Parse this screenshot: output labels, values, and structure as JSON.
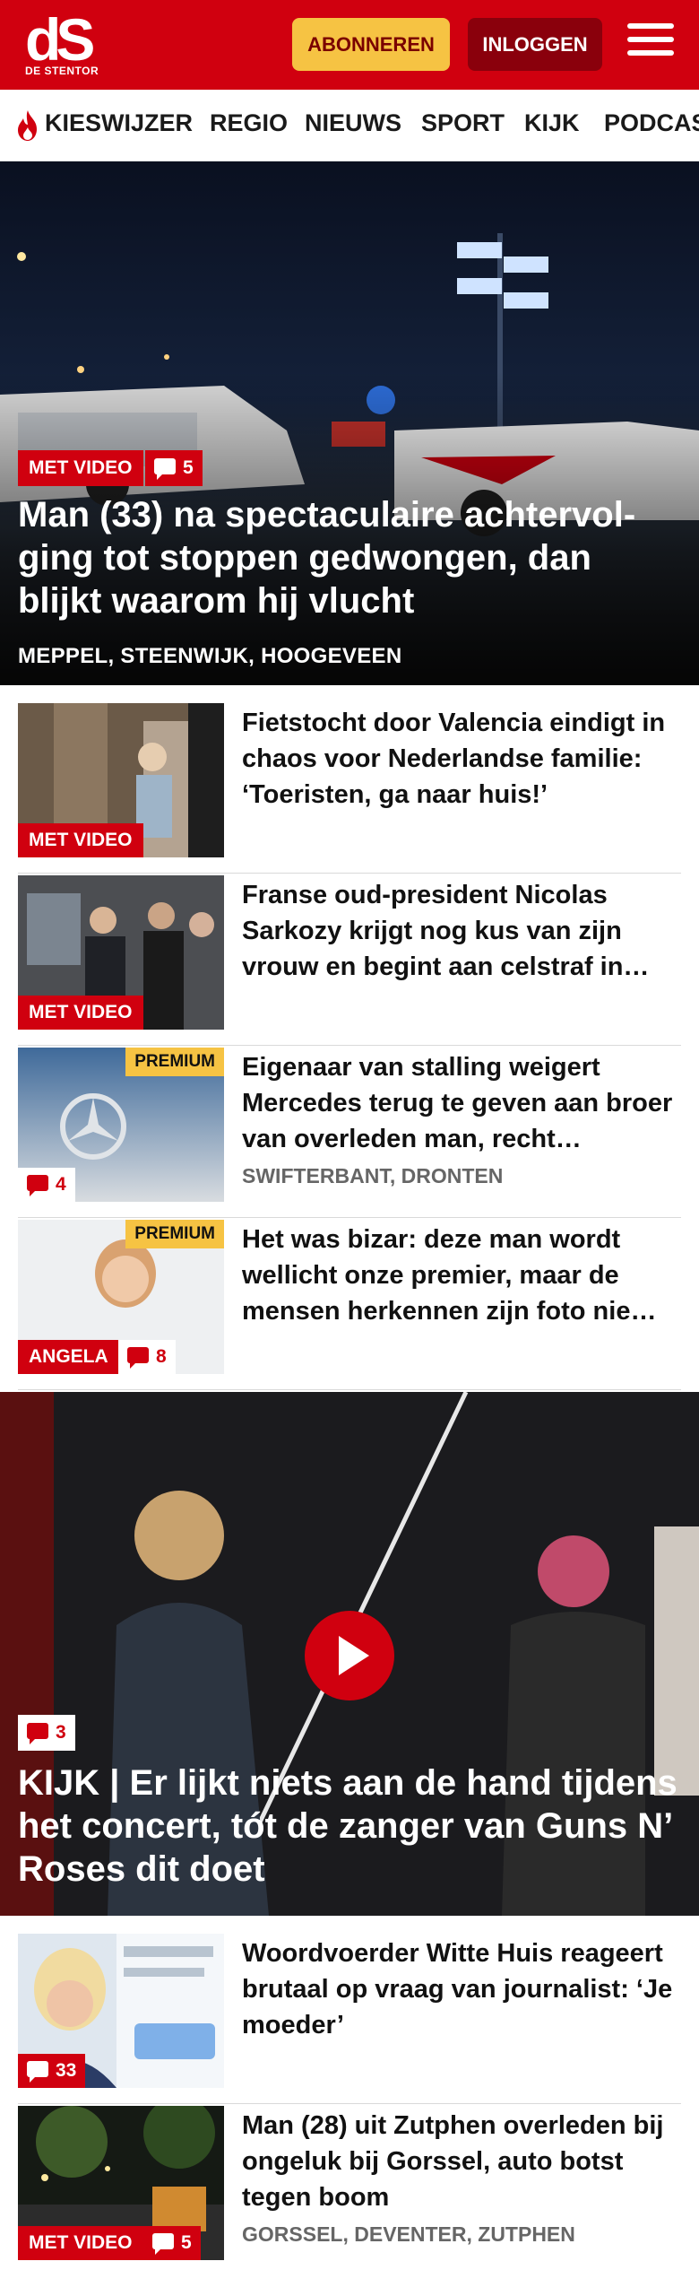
{
  "header": {
    "logo_mark": "dS",
    "logo_sub": "DE STENTOR",
    "subscribe_label": "ABONNEREN",
    "login_label": "INLOGGEN",
    "brand_color": "#d0000f"
  },
  "nav": {
    "items": [
      {
        "label": "KIESWIJZER",
        "icon": "flame-icon"
      },
      {
        "label": "REGIO"
      },
      {
        "label": "NIEUWS"
      },
      {
        "label": "SPORT"
      },
      {
        "label": "KIJK"
      },
      {
        "label": "PODCAS"
      }
    ]
  },
  "hero": {
    "badge": "MET VIDEO",
    "comments": "5",
    "title": "Man (33) na spectaculaire achtervol­ging tot stoppen gedwongen, dan blijkt waarom hij vlucht",
    "locations": "MEPPEL, STEENWIJK, HOOGEVEEN"
  },
  "articles": [
    {
      "title": "Fietstocht door Valencia eindigt in chaos voor Nederlandse familie: ‘Toeristen, ga naar huis!’",
      "badge": "MET VIDEO"
    },
    {
      "title": "Franse oud-president Nicolas Sarkozy krijgt nog kus van zijn vrouw en begint aan celstraf in…",
      "badge": "MET VIDEO"
    },
    {
      "title": "Eigenaar van stalling weigert Mercedes terug te geven aan broer van overleden man, recht…",
      "premium": "PREMIUM",
      "comments": "4",
      "locations": "SWIFTERBANT, DRONTEN"
    },
    {
      "title": "Het was bizar: deze man wordt wellicht onze premier, maar de mensen herkennen zijn foto nie…",
      "premium": "PREMIUM",
      "badge": "ANGELA",
      "comments": "8"
    }
  ],
  "feature": {
    "comments": "3",
    "title": "KIJK | Er lijkt niets aan de hand tijdens het concert, tót de zanger van Guns N’ Roses dit doet"
  },
  "articles2": [
    {
      "title": "Woordvoerder Witte Huis reageert brutaal op vraag van journalist: ‘Je moeder’",
      "comments": "33"
    },
    {
      "title": "Man (28) uit Zutphen overleden bij ongeluk bij Gorssel, auto botst tegen boom",
      "badge": "MET VIDEO",
      "comments": "5",
      "locations": "GORSSEL, DEVENTER, ZUTPHEN"
    }
  ]
}
